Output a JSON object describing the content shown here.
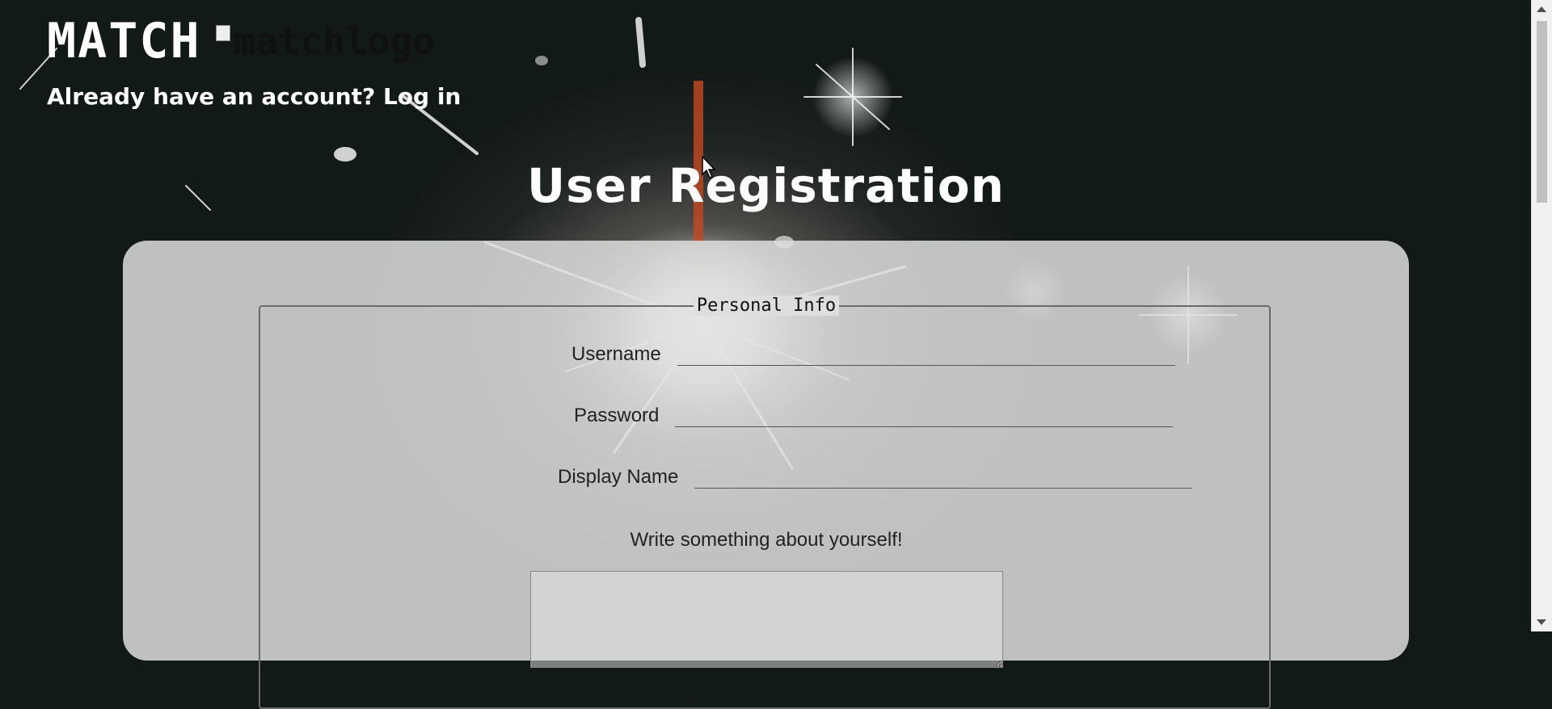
{
  "header": {
    "brand": "MATCH",
    "logo_alt": "matchlogo",
    "account_prompt": "Already have an account?",
    "login_link": "Log in"
  },
  "page_title": "User Registration",
  "form": {
    "legend": "Personal Info",
    "fields": {
      "username_label": "Username",
      "username_value": "",
      "password_label": "Password",
      "password_value": "",
      "display_name_label": "Display Name",
      "display_name_value": ""
    },
    "about_label": "Write something about yourself!",
    "about_value": ""
  },
  "colors": {
    "background_dark": "#121a18",
    "card_bg": "#dedede",
    "text_light": "#ffffff",
    "text_dark": "#222222"
  }
}
